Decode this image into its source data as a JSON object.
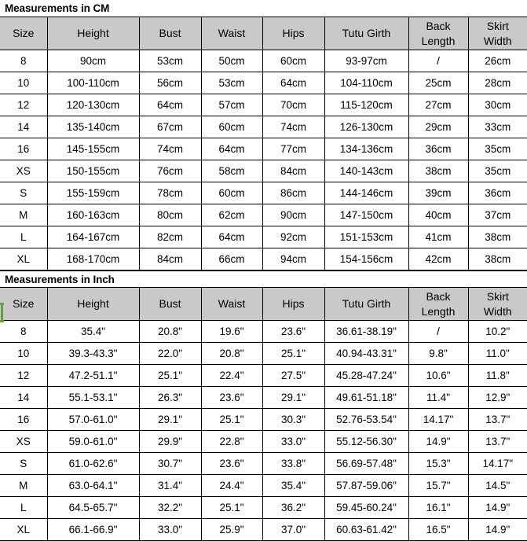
{
  "sections": [
    {
      "title": "Measurements in CM",
      "headers": [
        "Size",
        "Height",
        "Bust",
        "Waist",
        "Hips",
        "Tutu Girth",
        "Back Length",
        "Skirt Width"
      ],
      "rows": [
        [
          "8",
          "90cm",
          "53cm",
          "50cm",
          "60cm",
          "93-97cm",
          "/",
          "26cm"
        ],
        [
          "10",
          "100-110cm",
          "56cm",
          "53cm",
          "64cm",
          "104-110cm",
          "25cm",
          "28cm"
        ],
        [
          "12",
          "120-130cm",
          "64cm",
          "57cm",
          "70cm",
          "115-120cm",
          "27cm",
          "30cm"
        ],
        [
          "14",
          "135-140cm",
          "67cm",
          "60cm",
          "74cm",
          "126-130cm",
          "29cm",
          "33cm"
        ],
        [
          "16",
          "145-155cm",
          "74cm",
          "64cm",
          "77cm",
          "134-136cm",
          "36cm",
          "35cm"
        ],
        [
          "XS",
          "150-155cm",
          "76cm",
          "58cm",
          "84cm",
          "140-143cm",
          "38cm",
          "35cm"
        ],
        [
          "S",
          "155-159cm",
          "78cm",
          "60cm",
          "86cm",
          "144-146cm",
          "39cm",
          "36cm"
        ],
        [
          "M",
          "160-163cm",
          "80cm",
          "62cm",
          "90cm",
          "147-150cm",
          "40cm",
          "37cm"
        ],
        [
          "L",
          "164-167cm",
          "82cm",
          "64cm",
          "92cm",
          "151-153cm",
          "41cm",
          "38cm"
        ],
        [
          "XL",
          "168-170cm",
          "84cm",
          "66cm",
          "94cm",
          "154-156cm",
          "42cm",
          "38cm"
        ]
      ]
    },
    {
      "title": "Measurements in Inch",
      "headers": [
        "Size",
        "Height",
        "Bust",
        "Waist",
        "Hips",
        "Tutu Girth",
        "Back Length",
        "Skirt Width"
      ],
      "rows": [
        [
          "8",
          "35.4\"",
          "20.8\"",
          "19.6\"",
          "23.6\"",
          "36.61-38.19\"",
          "/",
          "10.2\""
        ],
        [
          "10",
          "39.3-43.3\"",
          "22.0\"",
          "20.8\"",
          "25.1\"",
          "40.94-43.31\"",
          "9.8\"",
          "11.0\""
        ],
        [
          "12",
          "47.2-51.1\"",
          "25.1\"",
          "22.4\"",
          "27.5\"",
          "45.28-47.24\"",
          "10.6\"",
          "11.8\""
        ],
        [
          "14",
          "55.1-53.1\"",
          "26.3\"",
          "23.6\"",
          "29.1\"",
          "49.61-51.18\"",
          "11.4\"",
          "12.9\""
        ],
        [
          "16",
          "57.0-61.0\"",
          "29.1\"",
          "25.1\"",
          "30.3\"",
          "52.76-53.54\"",
          "14.17\"",
          "13.7\""
        ],
        [
          "XS",
          "59.0-61.0\"",
          "29.9\"",
          "22.8\"",
          "33.0\"",
          "55.12-56.30\"",
          "14.9\"",
          "13.7\""
        ],
        [
          "S",
          "61.0-62.6\"",
          "30.7\"",
          "23.6\"",
          "33.8\"",
          "56.69-57.48\"",
          "15.3\"",
          "14.17\""
        ],
        [
          "M",
          "63.0-64.1\"",
          "31.4\"",
          "24.4\"",
          "35.4\"",
          "57.87-59.06\"",
          "15.7\"",
          "14.5\""
        ],
        [
          "L",
          "64.5-65.7\"",
          "32.2\"",
          "25.1\"",
          "36.2\"",
          "59.45-60.24\"",
          "16.1\"",
          "14.9\""
        ],
        [
          "XL",
          "66.1-66.9\"",
          "33.0\"",
          "25.9\"",
          "37.0\"",
          "60.63-61.42\"",
          "16.5\"",
          "14.9\""
        ]
      ]
    }
  ],
  "selection": {
    "color": "#6a9a4e",
    "row_label": "8"
  },
  "colors": {
    "header_background": "#c9c9c9",
    "grid_line": "#000000",
    "cell_background": "#ffffff",
    "text": "#000000"
  }
}
